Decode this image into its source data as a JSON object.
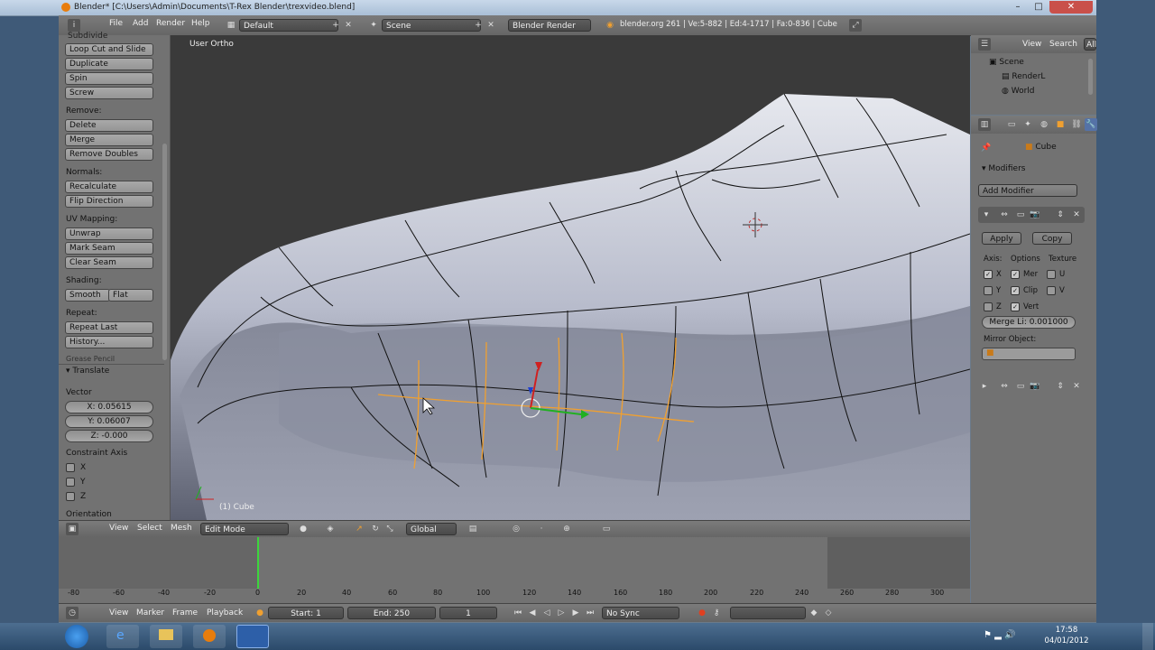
{
  "window": {
    "title": "Blender* [C:\\Users\\Admin\\Documents\\T-Rex Blender\\trexvideo.blend]",
    "min": "–",
    "max": "□",
    "close": "✕"
  },
  "topmenu": {
    "file": "File",
    "add": "Add",
    "render": "Render",
    "help": "Help",
    "layout": "Default",
    "scene": "Scene",
    "engine": "Blender Render",
    "stats": "blender.org 261 | Ve:5-882 | Ed:4-1717 | Fa:0-836 | Cube"
  },
  "toolshelf": {
    "partial_top": "Subdivide",
    "buttons_add": [
      "Loop Cut and Slide",
      "Duplicate",
      "Spin",
      "Screw"
    ],
    "remove_label": "Remove:",
    "buttons_remove": [
      "Delete",
      "Merge",
      "Remove Doubles"
    ],
    "normals_label": "Normals:",
    "buttons_normals": [
      "Recalculate",
      "Flip Direction"
    ],
    "uv_label": "UV Mapping:",
    "buttons_uv": [
      "Unwrap",
      "Mark Seam",
      "Clear Seam"
    ],
    "shading_label": "Shading:",
    "smooth": "Smooth",
    "flat": "Flat",
    "repeat_label": "Repeat:",
    "repeat_last": "Repeat Last",
    "history": "History...",
    "grease_pencil": "Grease Pencil",
    "operator_title": "Translate",
    "vector_label": "Vector",
    "x": "X: 0.05615",
    "y": "Y: 0.06007",
    "z": "Z: -0.000",
    "constraint_label": "Constraint Axis",
    "cx": "X",
    "cy": "Y",
    "cz": "Z",
    "orientation": "Orientation"
  },
  "viewport": {
    "view_name": "User Ortho",
    "object_label": "(1) Cube"
  },
  "viewheader": {
    "view": "View",
    "select": "Select",
    "mesh": "Mesh",
    "mode": "Edit Mode",
    "orientation": "Global"
  },
  "timeline": {
    "ticks": [
      "-80",
      "-60",
      "-40",
      "-20",
      "0",
      "20",
      "40",
      "60",
      "80",
      "100",
      "120",
      "140",
      "160",
      "180",
      "200",
      "220",
      "240",
      "260",
      "280",
      "300"
    ],
    "current_frame_marker": 0
  },
  "tlheader": {
    "view": "View",
    "marker": "Marker",
    "frame": "Frame",
    "playback": "Playback",
    "start": "Start: 1",
    "end": "End: 250",
    "current": "1",
    "sync": "No Sync"
  },
  "outliner": {
    "view": "View",
    "search": "Search",
    "all": "All",
    "items": [
      "Scene",
      "RenderL",
      "World"
    ]
  },
  "properties": {
    "object": "Cube",
    "modifiers_title": "Modifiers",
    "add_modifier": "Add Modifier",
    "apply": "Apply",
    "copy": "Copy",
    "axis": "Axis:",
    "options": "Options",
    "texture": "Texture",
    "x": "X",
    "y": "Y",
    "z": "Z",
    "mer": "Mer",
    "clip": "Clip",
    "vert": "Vert",
    "u": "U",
    "v": "V",
    "merge_limit": "Merge Li: 0.001000",
    "mirror_object": "Mirror Object:"
  },
  "taskbar": {
    "time": "17:58",
    "date": "04/01/2012"
  },
  "colors": {
    "selection": "#f0a030",
    "panel": "#727272",
    "header": "#6e6e6e",
    "desktop": "#3f5a78"
  }
}
